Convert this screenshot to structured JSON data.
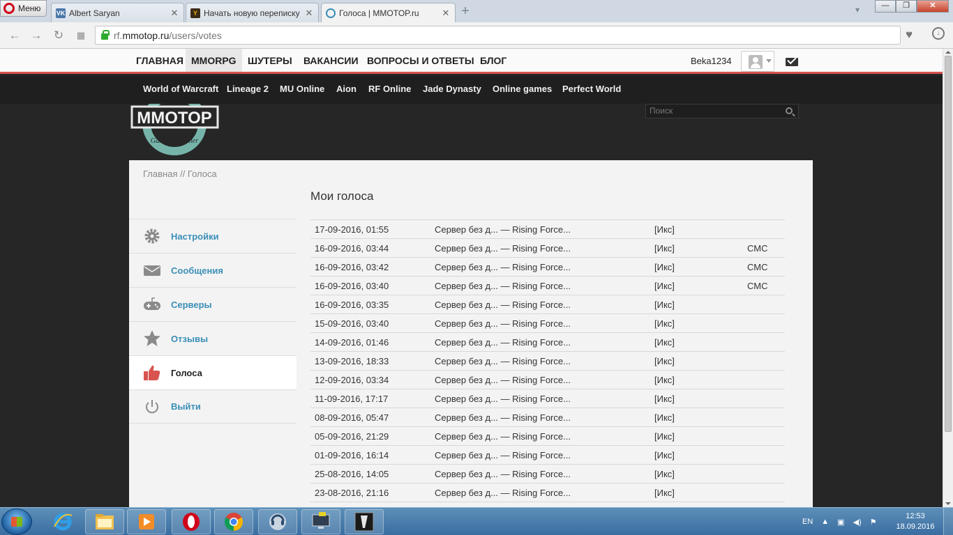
{
  "browser": {
    "menu_label": "Меню",
    "tabs": [
      {
        "title": "Albert Saryan",
        "favicon": "VK"
      },
      {
        "title": "Начать новую переписку",
        "favicon": "Y"
      },
      {
        "title": "Голоса | MMOTOP.ru",
        "favicon": "MT"
      }
    ],
    "url_prefix": "rf.",
    "url_domain": "mmotop.ru",
    "url_path": "/users/votes"
  },
  "topnav": {
    "items": [
      "ГЛАВНАЯ",
      "MMORPG",
      "ШУТЕРЫ",
      "ВАКАНСИИ",
      "ВОПРОСЫ И ОТВЕТЫ",
      "БЛОГ"
    ],
    "active_index": 1,
    "username": "Beka1234"
  },
  "gamenav": {
    "items": [
      "World of Warcraft",
      "Lineage 2",
      "MU Online",
      "Aion",
      "RF Online",
      "Jade Dynasty",
      "Online games",
      "Perfect World"
    ]
  },
  "logo": {
    "main": "MMOTOP",
    "sub": "Game Controller"
  },
  "search": {
    "placeholder": "Поиск"
  },
  "breadcrumb": "Главная // Голоса",
  "page_title": "Мои голоса",
  "sidebar": {
    "items": [
      {
        "label": "Настройки",
        "icon": "gear-icon"
      },
      {
        "label": "Сообщения",
        "icon": "envelope-icon"
      },
      {
        "label": "Серверы",
        "icon": "gamepad-icon"
      },
      {
        "label": "Отзывы",
        "icon": "star-icon"
      },
      {
        "label": "Голоса",
        "icon": "thumbs-up-icon"
      },
      {
        "label": "Выйти",
        "icon": "power-icon"
      }
    ],
    "active_index": 4
  },
  "votes": [
    {
      "date": "17-09-2016, 01:55",
      "server": "Сервер без д... — Rising Force...",
      "link": "[Икс]",
      "type": ""
    },
    {
      "date": "16-09-2016, 03:44",
      "server": "Сервер без д... — Rising Force...",
      "link": "[Икс]",
      "type": "СМС"
    },
    {
      "date": "16-09-2016, 03:42",
      "server": "Сервер без д... — Rising Force...",
      "link": "[Икс]",
      "type": "СМС"
    },
    {
      "date": "16-09-2016, 03:40",
      "server": "Сервер без д... — Rising Force...",
      "link": "[Икс]",
      "type": "СМС"
    },
    {
      "date": "16-09-2016, 03:35",
      "server": "Сервер без д... — Rising Force...",
      "link": "[Икс]",
      "type": ""
    },
    {
      "date": "15-09-2016, 03:40",
      "server": "Сервер без д... — Rising Force...",
      "link": "[Икс]",
      "type": ""
    },
    {
      "date": "14-09-2016, 01:46",
      "server": "Сервер без д... — Rising Force...",
      "link": "[Икс]",
      "type": ""
    },
    {
      "date": "13-09-2016, 18:33",
      "server": "Сервер без д... — Rising Force...",
      "link": "[Икс]",
      "type": ""
    },
    {
      "date": "12-09-2016, 03:34",
      "server": "Сервер без д... — Rising Force...",
      "link": "[Икс]",
      "type": ""
    },
    {
      "date": "11-09-2016, 17:17",
      "server": "Сервер без д... — Rising Force...",
      "link": "[Икс]",
      "type": ""
    },
    {
      "date": "08-09-2016, 05:47",
      "server": "Сервер без д... — Rising Force...",
      "link": "[Икс]",
      "type": ""
    },
    {
      "date": "05-09-2016, 21:29",
      "server": "Сервер без д... — Rising Force...",
      "link": "[Икс]",
      "type": ""
    },
    {
      "date": "01-09-2016, 16:14",
      "server": "Сервер без д... — Rising Force...",
      "link": "[Икс]",
      "type": ""
    },
    {
      "date": "25-08-2016, 14:05",
      "server": "Сервер без д... — Rising Force...",
      "link": "[Икс]",
      "type": ""
    },
    {
      "date": "23-08-2016, 21:16",
      "server": "Сервер без д... — Rising Force...",
      "link": "[Икс]",
      "type": ""
    }
  ],
  "taskbar": {
    "lang": "EN",
    "time": "12:53",
    "date": "18.09.2016"
  },
  "colors": {
    "accent_red": "#d9534f",
    "link_blue": "#3a8fb7",
    "logo_teal": "#7fc4b8"
  }
}
